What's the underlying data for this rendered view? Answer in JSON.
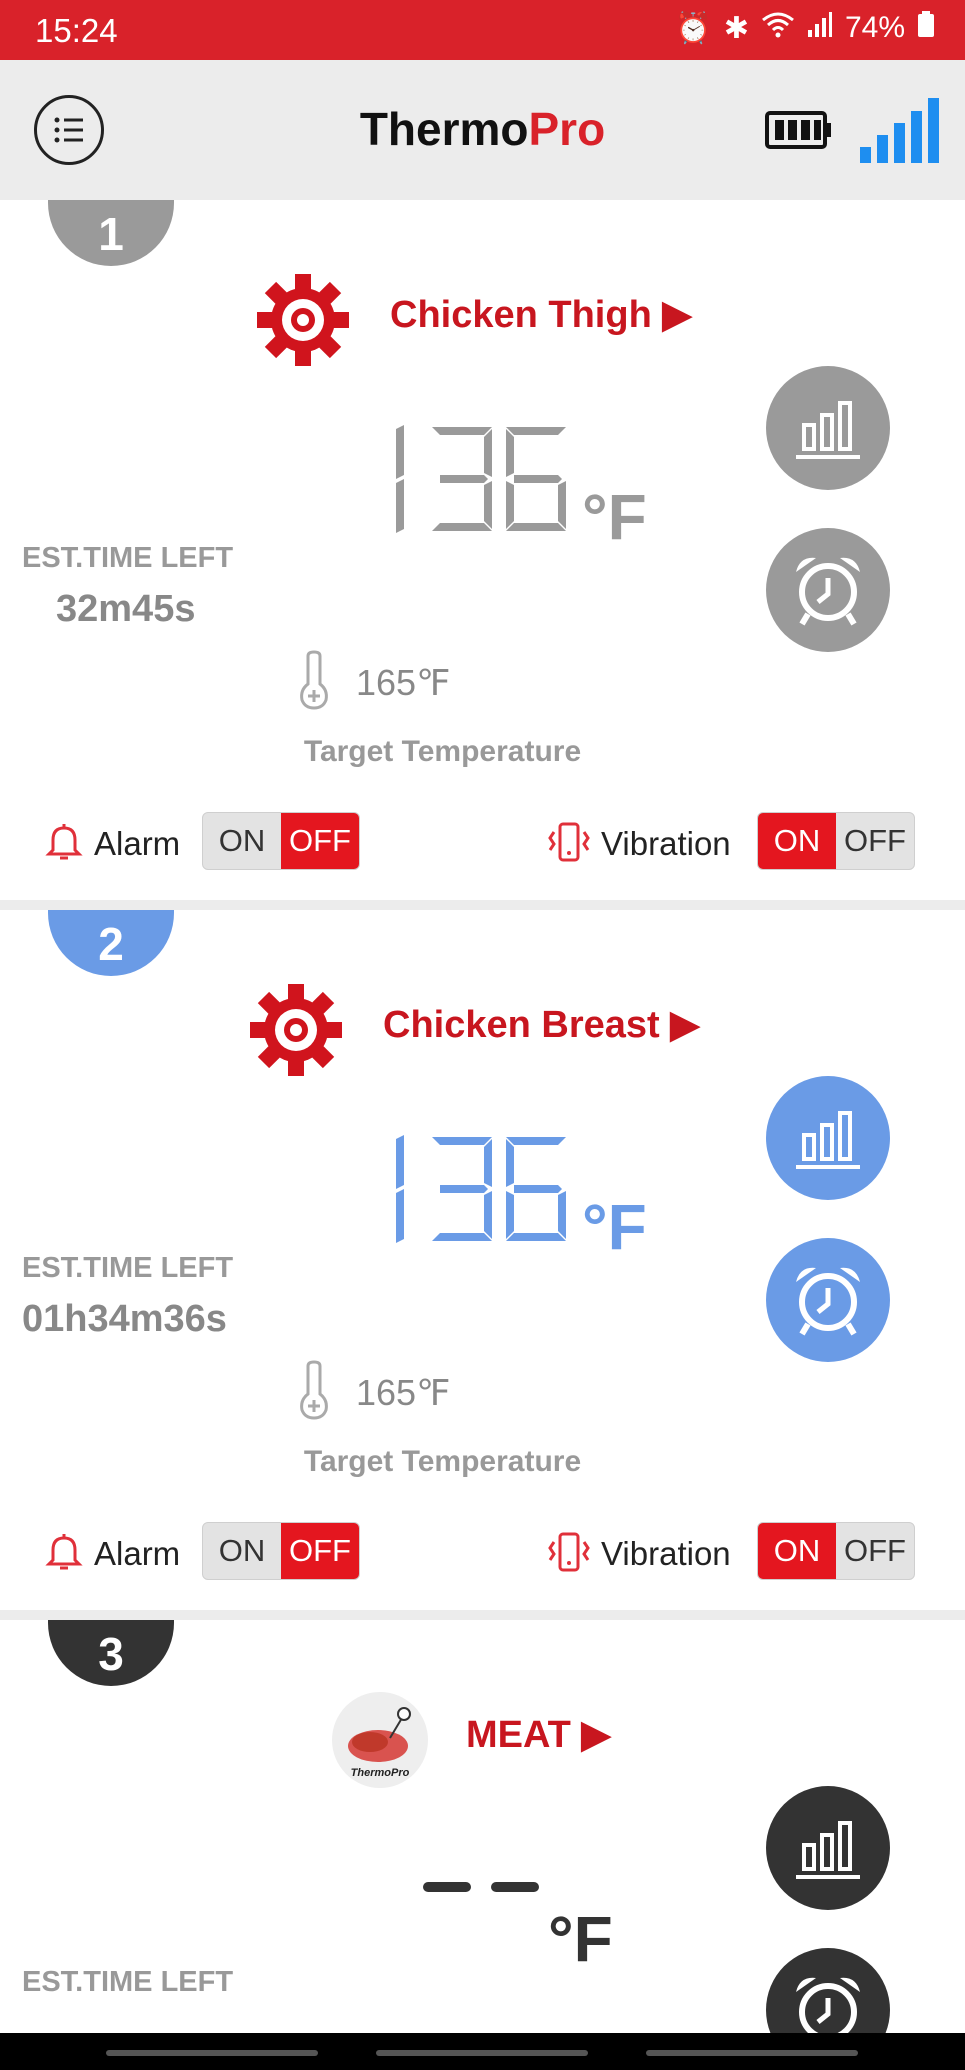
{
  "status_bar": {
    "time": "15:24",
    "battery": "74%"
  },
  "app_bar": {
    "title_part1": "Thermo",
    "title_part2": "Pro"
  },
  "probes": [
    {
      "number": "1",
      "food": "Chicken Thigh ▶",
      "temperature": "136",
      "unit": "°F",
      "est_label": "EST.TIME LEFT",
      "est_time": "32m45s",
      "target_temp": "165℉",
      "target_label": "Target Temperature",
      "alarm_label": "Alarm",
      "alarm_on": "ON",
      "alarm_off": "OFF",
      "alarm_state": "OFF",
      "vibration_label": "Vibration",
      "vibration_on": "ON",
      "vibration_off": "OFF",
      "vibration_state": "ON",
      "color": "#9a9a9a"
    },
    {
      "number": "2",
      "food": "Chicken Breast ▶",
      "temperature": "136",
      "unit": "°F",
      "est_label": "EST.TIME LEFT",
      "est_time": "01h34m36s",
      "target_temp": "165℉",
      "target_label": "Target Temperature",
      "alarm_label": "Alarm",
      "alarm_on": "ON",
      "alarm_off": "OFF",
      "alarm_state": "OFF",
      "vibration_label": "Vibration",
      "vibration_on": "ON",
      "vibration_off": "OFF",
      "vibration_state": "ON",
      "color": "#6a9be6"
    },
    {
      "number": "3",
      "food": "MEAT ▶",
      "temperature": "– –",
      "unit": "°F",
      "est_label": "EST.TIME LEFT",
      "logo_text": "ThermoPro",
      "color": "#333333"
    }
  ],
  "colors": {
    "accent": "#d9222a",
    "probe1": "#9a9a9a",
    "probe2": "#6a9be6",
    "probe3": "#333333"
  }
}
